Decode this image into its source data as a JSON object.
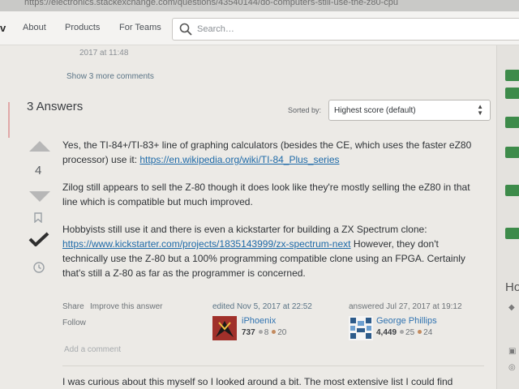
{
  "browser": {
    "url": "https://electronics.stackexchange.com/questions/43540144/do-computers-still-use-the-z80-cpu"
  },
  "topbar": {
    "logo_fragment": "v",
    "nav": [
      "About",
      "Products",
      "For Teams"
    ],
    "search_placeholder": "Search…"
  },
  "question_footer": {
    "comment_date": "2017 at 11:48",
    "show_more": "Show 3 more comments"
  },
  "answers_header": {
    "title": "3 Answers",
    "sorted_by_label": "Sorted by:",
    "sort_value": "Highest score (default)"
  },
  "answer": {
    "vote_count": "4",
    "p1_text": "Yes, the TI-84+/TI-83+ line of graphing calculators (besides the CE, which uses the faster eZ80 processor) use it: ",
    "p1_link": "https://en.wikipedia.org/wiki/TI-84_Plus_series",
    "p2_text": "Zilog still appears to sell the Z-80 though it does look like they're mostly selling the eZ80 in that line which is compatible but much improved.",
    "p3_text_a": "Hobbyists still use it and there is even a kickstarter for building a ZX Spectrum clone: ",
    "p3_link": "https://www.kickstarter.com/projects/1835143999/zx-spectrum-next",
    "p3_text_b": " However, they don't technically use the Z-80 but a 100% programming compatible clone using an FPGA. Certainly that's still a Z-80 as far as the programmer is concerned.",
    "share": "Share",
    "improve": "Improve this answer",
    "follow": "Follow",
    "edited": "edited Nov 5, 2017 at 22:52",
    "editor": {
      "name": "iPhoenix",
      "rep": "737",
      "silver": "8",
      "bronze": "20"
    },
    "answered": "answered Jul 27, 2017 at 19:12",
    "author": {
      "name": "George Phillips",
      "rep": "4,449",
      "silver": "25",
      "bronze": "24"
    },
    "add_comment": "Add a comment"
  },
  "next_answer": {
    "text": "I was curious about this myself so I looked around a bit. The most extensive list I could find"
  },
  "right_sidebar": {
    "heading_fragment": "Ho"
  },
  "colors": {
    "link": "#1e6aa8",
    "accepted": "#2f2f2f",
    "silver": "#a8a8a8",
    "bronze": "#c38b5f",
    "sidebar_green": "#3d8b4a"
  }
}
